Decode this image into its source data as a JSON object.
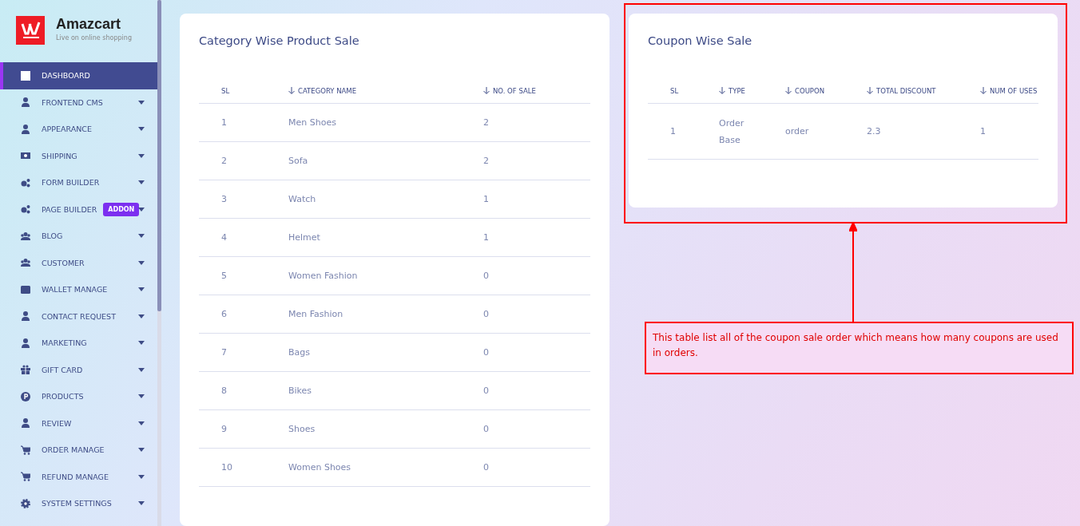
{
  "brand": {
    "name": "Amazcart",
    "tagline": "Live on online shopping"
  },
  "sidebar": {
    "items": [
      {
        "label": "DASHBOARD",
        "kind": "link",
        "selected": true
      },
      {
        "label": "FRONTEND CMS",
        "kind": "submenu",
        "selected": false
      },
      {
        "label": "APPEARANCE",
        "kind": "submenu",
        "selected": false
      },
      {
        "label": "SHIPPING",
        "kind": "submenu",
        "selected": false
      },
      {
        "label": "FORM BUILDER",
        "kind": "submenu",
        "selected": false
      },
      {
        "label": "PAGE BUILDER",
        "kind": "submenu",
        "selected": false,
        "badge": "ADDON"
      },
      {
        "label": "BLOG",
        "kind": "submenu",
        "selected": false
      },
      {
        "label": "CUSTOMER",
        "kind": "submenu",
        "selected": false
      },
      {
        "label": "WALLET MANAGE",
        "kind": "submenu",
        "selected": false
      },
      {
        "label": "CONTACT REQUEST",
        "kind": "submenu",
        "selected": false
      },
      {
        "label": "MARKETING",
        "kind": "submenu",
        "selected": false
      },
      {
        "label": "GIFT CARD",
        "kind": "submenu",
        "selected": false
      },
      {
        "label": "PRODUCTS",
        "kind": "submenu",
        "selected": false
      },
      {
        "label": "REVIEW",
        "kind": "submenu",
        "selected": false
      },
      {
        "label": "ORDER MANAGE",
        "kind": "submenu",
        "selected": false
      },
      {
        "label": "REFUND MANAGE",
        "kind": "submenu",
        "selected": false
      },
      {
        "label": "SYSTEM SETTINGS",
        "kind": "submenu",
        "selected": false
      }
    ]
  },
  "category_sale": {
    "title": "Category Wise Product Sale",
    "columns": [
      {
        "label": "SL",
        "sortable": false
      },
      {
        "label": "CATEGORY NAME",
        "sortable": true
      },
      {
        "label": "NO. OF SALE",
        "sortable": true
      }
    ],
    "rows": [
      [
        "1",
        "Men Shoes",
        "2"
      ],
      [
        "2",
        "Sofa",
        "2"
      ],
      [
        "3",
        "Watch",
        "1"
      ],
      [
        "4",
        "Helmet",
        "1"
      ],
      [
        "5",
        "Women Fashion",
        "0"
      ],
      [
        "6",
        "Men Fashion",
        "0"
      ],
      [
        "7",
        "Bags",
        "0"
      ],
      [
        "8",
        "Bikes",
        "0"
      ],
      [
        "9",
        "Shoes",
        "0"
      ],
      [
        "10",
        "Women Shoes",
        "0"
      ]
    ]
  },
  "coupon_sale": {
    "title": "Coupon Wise Sale",
    "columns": [
      {
        "label": "SL",
        "sortable": false
      },
      {
        "label": "TYPE",
        "sortable": true
      },
      {
        "label": "COUPON",
        "sortable": true
      },
      {
        "label": "TOTAL DISCOUNT",
        "sortable": true
      },
      {
        "label": "NUM OF USES",
        "sortable": true
      }
    ],
    "rows": [
      [
        "1",
        "Order Base",
        "order",
        "2.3",
        "1"
      ]
    ]
  },
  "annotation": {
    "text": "This table list all of the coupon sale order which means how many coupons are used in orders."
  }
}
